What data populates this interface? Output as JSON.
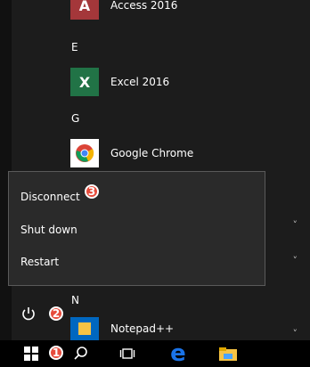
{
  "apps": [
    {
      "name": "Access 2016",
      "tile_text": "A",
      "color": "#a4373a"
    },
    {
      "name": "Excel 2016",
      "tile_text": "X",
      "color": "#217346"
    },
    {
      "name": "Google Chrome",
      "tile_text": "",
      "color": "#ffffff"
    }
  ],
  "letters": [
    "E",
    "G",
    "N"
  ],
  "power_menu": {
    "items": [
      "Disconnect",
      "Shut down",
      "Restart"
    ]
  },
  "badges": [
    "1",
    "2",
    "3"
  ],
  "chevrons": [
    "˅",
    "˅",
    "˅"
  ],
  "apps2": {
    "notepad": "Notepad++"
  },
  "colors": {
    "background": "#1c1c1c",
    "menu": "#2a2a2a",
    "badge": "#e74c3c",
    "notepad_tile": "#0067c0",
    "ie": "#1a73e8",
    "explorer": "#f6c344"
  }
}
